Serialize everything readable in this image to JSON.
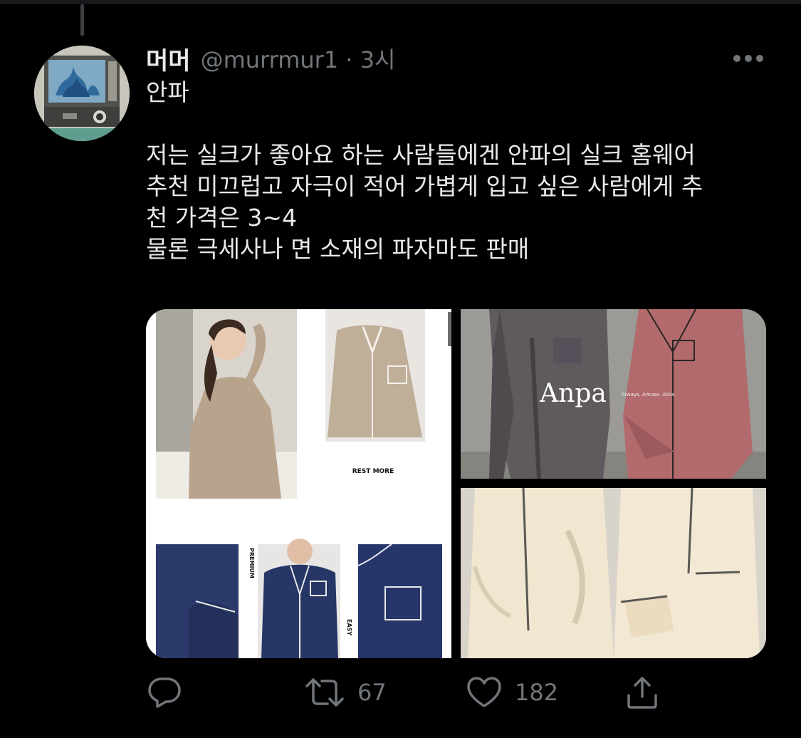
{
  "tweet": {
    "display_name": "머머",
    "handle_time": "@murrmur1 · 3시",
    "body_lines": [
      "안파",
      "",
      "저는 실크가 좋아요 하는 사람들에겐 안파의 실크 홈웨어",
      "추천 미끄럽고 자극이 적어 가볍게 입고 싶은 사람에게 추",
      "천 가격은 3~4",
      "물론 극세사나 면 소재의 파자마도 판매"
    ]
  },
  "media": {
    "left_image": {
      "rest_more_label": "REST MORE",
      "premium_label": "PREMIUM",
      "easy_label": "EASY"
    },
    "top_right_image": {
      "brand_logo": "Anpa",
      "brand_tagline": "Always. Amuse. Alice."
    }
  },
  "actions": {
    "reply_icon": "reply-icon",
    "retweet_icon": "retweet-icon",
    "retweet_count": "67",
    "like_icon": "heart-icon",
    "like_count": "182",
    "share_icon": "share-icon"
  },
  "colors": {
    "background": "#000000",
    "text_primary": "#e7e9ea",
    "text_secondary": "#71767b"
  }
}
